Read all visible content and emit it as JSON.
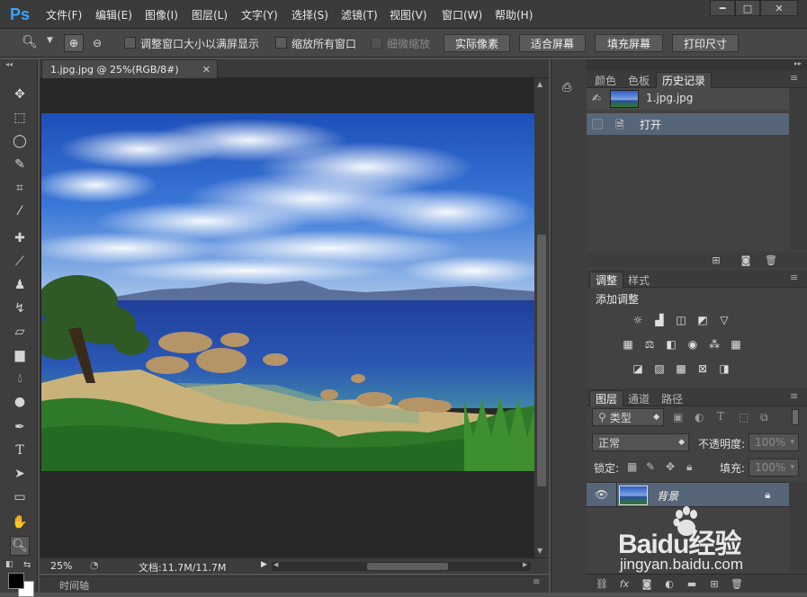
{
  "app": {
    "logo": "Ps"
  },
  "menu": [
    "文件(F)",
    "编辑(E)",
    "图像(I)",
    "图层(L)",
    "文字(Y)",
    "选择(S)",
    "滤镜(T)",
    "视图(V)",
    "窗口(W)",
    "帮助(H)"
  ],
  "options": {
    "checkbox1": "调整窗口大小以满屏显示",
    "checkbox2": "缩放所有窗口",
    "checkbox3": "细微缩放",
    "btn_actual": "实际像素",
    "btn_fit": "适合屏幕",
    "btn_fill": "填充屏幕",
    "btn_print": "打印尺寸"
  },
  "document": {
    "tab_title": "1.jpg.jpg @ 25%(RGB/8#)",
    "zoom": "25%",
    "doc_size": "文档:11.7M/11.7M",
    "timeline": "时间轴"
  },
  "history_panel": {
    "tabs": [
      "颜色",
      "色板",
      "历史记录"
    ],
    "snapshot_name": "1.jpg.jpg",
    "items": [
      "打开"
    ]
  },
  "adjust_panel": {
    "tabs": [
      "调整",
      "样式"
    ],
    "title": "添加调整"
  },
  "layers_panel": {
    "tabs": [
      "图层",
      "通道",
      "路径"
    ],
    "filter_kind": "类型",
    "blend_mode": "正常",
    "opacity_label": "不透明度:",
    "opacity_value": "100%",
    "lock_label": "锁定:",
    "fill_label": "填充:",
    "fill_value": "100%",
    "layer_name": "背景"
  },
  "watermark": {
    "brand": "Baidu经验",
    "url": "jingyan.baidu.com"
  },
  "colors": {
    "accent": "#3aa3ff",
    "selected_row": "#566577"
  }
}
